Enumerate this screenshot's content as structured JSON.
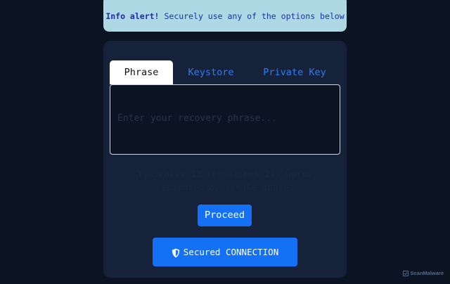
{
  "alert": {
    "title": "Info alert!",
    "message": "Securely use any of the options below"
  },
  "tabs": [
    {
      "label": "Phrase",
      "active": true
    },
    {
      "label": "Keystore",
      "active": false
    },
    {
      "label": "Private Key",
      "active": false
    }
  ],
  "phrase_input": {
    "value": "",
    "placeholder": "Enter your recovery phrase..."
  },
  "hint": {
    "text": "Typically 12 (sometimes 24) words separated by single spaces"
  },
  "proceed_button": {
    "label": "Proceed"
  },
  "secured_button": {
    "label": "Secured CONNECTION",
    "icon": "shield-icon"
  },
  "watermark": {
    "text": "ScanMalware",
    "icon": "scanmalware-logo-icon"
  },
  "colors": {
    "page_background": "#0c1424",
    "card_background": "#16213a",
    "alert_background": "#afd8e5",
    "accent": "#1470f5"
  }
}
